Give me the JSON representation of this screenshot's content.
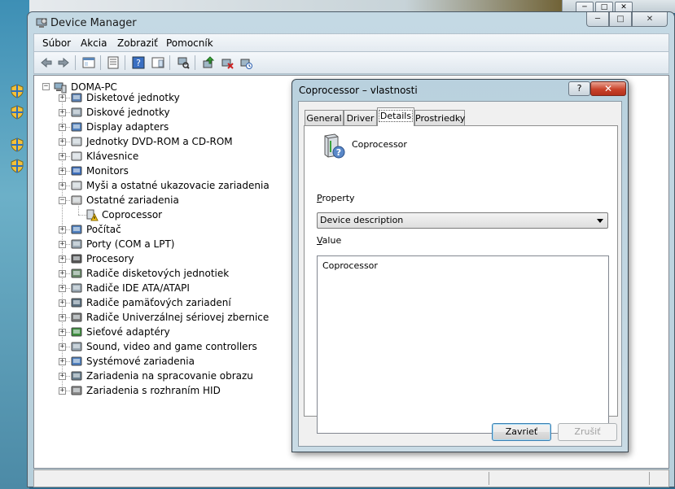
{
  "window": {
    "title": "Device Manager",
    "buttons": {
      "minimize": "─",
      "maximize": "□",
      "close": "✕"
    }
  },
  "background_window": {
    "buttons": {
      "minimize": "─",
      "maximize": "□",
      "close": "✕"
    }
  },
  "menu": [
    "Súbor",
    "Akcia",
    "Zobraziť",
    "Pomocník"
  ],
  "toolbar": {
    "buttons": [
      "back-arrow-icon",
      "forward-arrow-icon",
      "console-tree-icon",
      "properties-icon",
      "help-icon",
      "action-pane-icon",
      "scan-hardware-icon",
      "update-driver-icon",
      "disable-device-icon",
      "uninstall-device-icon"
    ]
  },
  "tree": {
    "root": "DOMA-PC",
    "items": [
      {
        "label": "Disketové jednotky",
        "icon": "floppy-drive-icon",
        "expander": "+"
      },
      {
        "label": "Diskové jednotky",
        "icon": "disk-drive-icon",
        "expander": "+"
      },
      {
        "label": "Display adapters",
        "icon": "display-adapter-icon",
        "expander": "+"
      },
      {
        "label": "Jednotky DVD-ROM a CD-ROM",
        "icon": "dvd-drive-icon",
        "expander": "+"
      },
      {
        "label": "Klávesnice",
        "icon": "keyboard-icon",
        "expander": "+"
      },
      {
        "label": "Monitors",
        "icon": "monitor-icon",
        "expander": "+"
      },
      {
        "label": "Myši a ostatné ukazovacie zariadenia",
        "icon": "mouse-icon",
        "expander": "+"
      },
      {
        "label": "Ostatné zariadenia",
        "icon": "unknown-device-icon",
        "expander": "−"
      },
      {
        "label": "Coprocessor",
        "icon": "warning-device-icon",
        "expander": ""
      },
      {
        "label": "Počítač",
        "icon": "computer-icon",
        "expander": "+"
      },
      {
        "label": "Porty (COM a LPT)",
        "icon": "port-icon",
        "expander": "+"
      },
      {
        "label": "Procesory",
        "icon": "processor-icon",
        "expander": "+"
      },
      {
        "label": "Radiče disketových jednotiek",
        "icon": "floppy-controller-icon",
        "expander": "+"
      },
      {
        "label": "Radiče IDE ATA/ATAPI",
        "icon": "ide-controller-icon",
        "expander": "+"
      },
      {
        "label": "Radiče pamäťových zariadení",
        "icon": "storage-controller-icon",
        "expander": "+"
      },
      {
        "label": "Radiče Univerzálnej sériovej zbernice",
        "icon": "usb-icon",
        "expander": "+"
      },
      {
        "label": "Sieťové adaptéry",
        "icon": "network-adapter-icon",
        "expander": "+"
      },
      {
        "label": "Sound, video and game controllers",
        "icon": "sound-icon",
        "expander": "+"
      },
      {
        "label": "Systémové zariadenia",
        "icon": "system-device-icon",
        "expander": "+"
      },
      {
        "label": "Zariadenia na spracovanie obrazu",
        "icon": "imaging-device-icon",
        "expander": "+"
      },
      {
        "label": "Zariadenia s rozhraním HID",
        "icon": "hid-icon",
        "expander": "+"
      }
    ]
  },
  "dialog": {
    "title": "Coprocessor – vlastnosti",
    "help_button": "?",
    "close_button": "✕",
    "tabs": [
      "General",
      "Driver",
      "Details",
      "Prostriedky"
    ],
    "active_tab": "Details",
    "device_name": "Coprocessor",
    "property_label_prefix": "P",
    "property_label_rest": "roperty",
    "property_value": "Device description",
    "value_label_prefix": "V",
    "value_label_rest": "alue",
    "value_text": "Coprocessor",
    "ok_button": "Zavrieť",
    "cancel_button": "Zrušiť"
  },
  "colors": {
    "title_bar": "#c4d9e4",
    "close_red": "#c9432b",
    "default_button_border": "#3c7fb1"
  }
}
